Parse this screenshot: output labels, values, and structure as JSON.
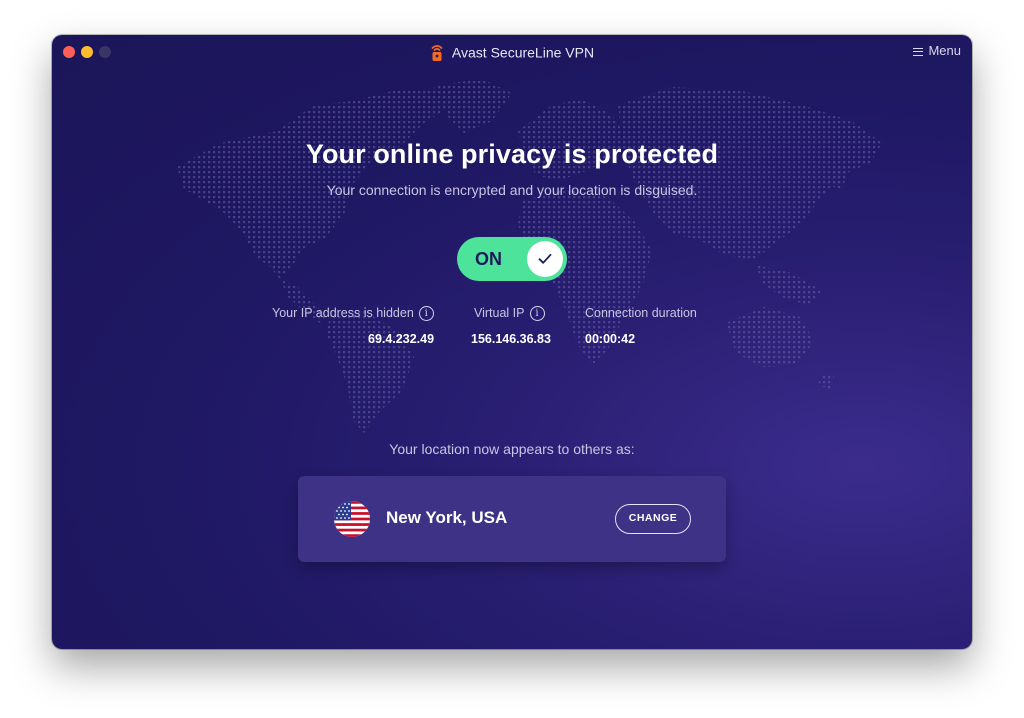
{
  "window": {
    "title": "Avast SecureLine VPN",
    "menu_label": "Menu"
  },
  "status": {
    "headline": "Your online privacy is protected",
    "subline": "Your connection is encrypted and your location is disguised."
  },
  "toggle": {
    "label": "ON",
    "state": "on",
    "color": "#4ee39a"
  },
  "stats": {
    "real_ip": {
      "label": "Your IP address is hidden",
      "value": "69.4.232.49",
      "icon": "info-icon"
    },
    "virtual_ip": {
      "label": "Virtual IP",
      "value": "156.146.36.83",
      "icon": "info-icon"
    },
    "duration": {
      "label": "Connection duration",
      "value": "00:00:42"
    }
  },
  "location": {
    "prompt": "Your location now appears to others as:",
    "city": "New York, USA",
    "flag_icon": "us-flag-icon",
    "change_label": "CHANGE"
  },
  "colors": {
    "background": "#1f1863",
    "accent": "#4ee39a",
    "card": "#3d3286",
    "logo": "#f26b21"
  }
}
